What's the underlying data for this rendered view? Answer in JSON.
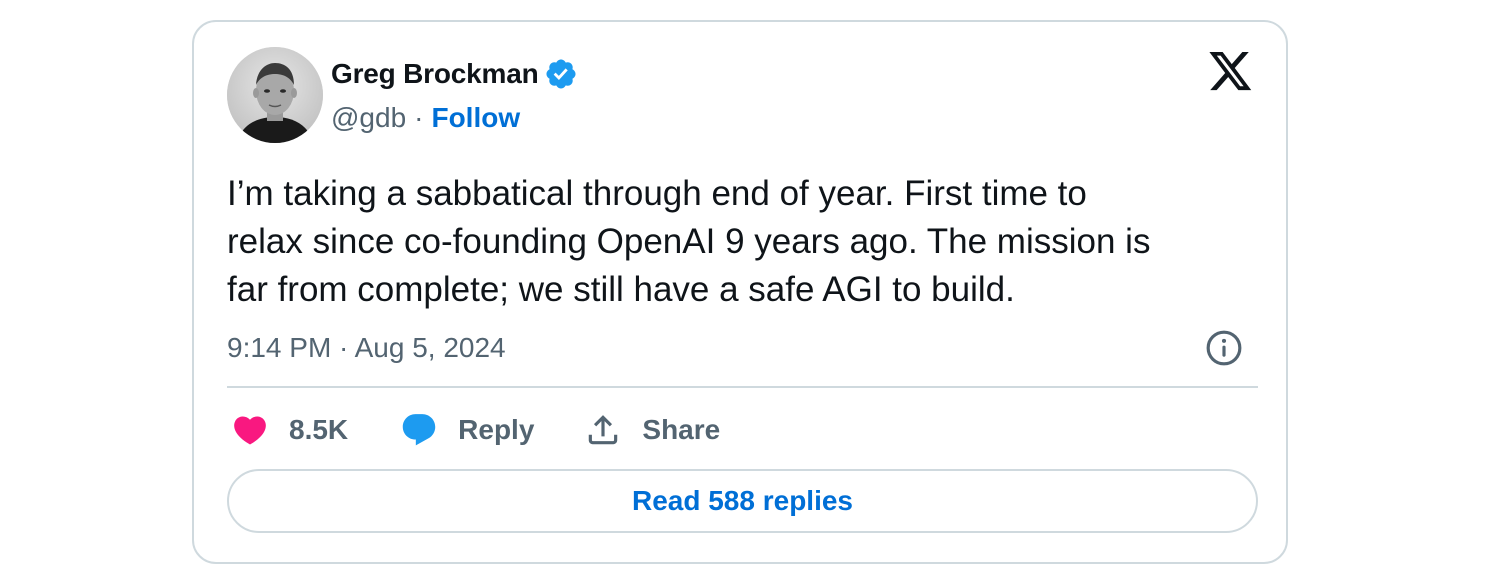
{
  "author": {
    "name": "Greg Brockman",
    "handle": "@gdb",
    "separator": "·",
    "follow_label": "Follow",
    "verified": true
  },
  "tweet": {
    "text": "I’m taking a sabbatical through end of year. First time to\nrelax since co-founding OpenAI 9 years ago. The mission is\nfar from complete; we still have a safe AGI to build.",
    "timestamp": "9:14 PM · Aug 5, 2024"
  },
  "actions": {
    "like_count": "8.5K",
    "reply_label": "Reply",
    "share_label": "Share"
  },
  "read_replies_label": "Read 588 replies",
  "icons": {
    "logo": "x-logo-icon",
    "verified": "verified-badge-icon",
    "info": "info-icon",
    "like": "heart-icon",
    "reply": "speech-bubble-icon",
    "share": "share-upload-icon"
  },
  "colors": {
    "accent": "#006fd6",
    "verified": "#1d9bf0",
    "like": "#f91880",
    "muted_text": "#536471",
    "border": "#cfd9de"
  }
}
